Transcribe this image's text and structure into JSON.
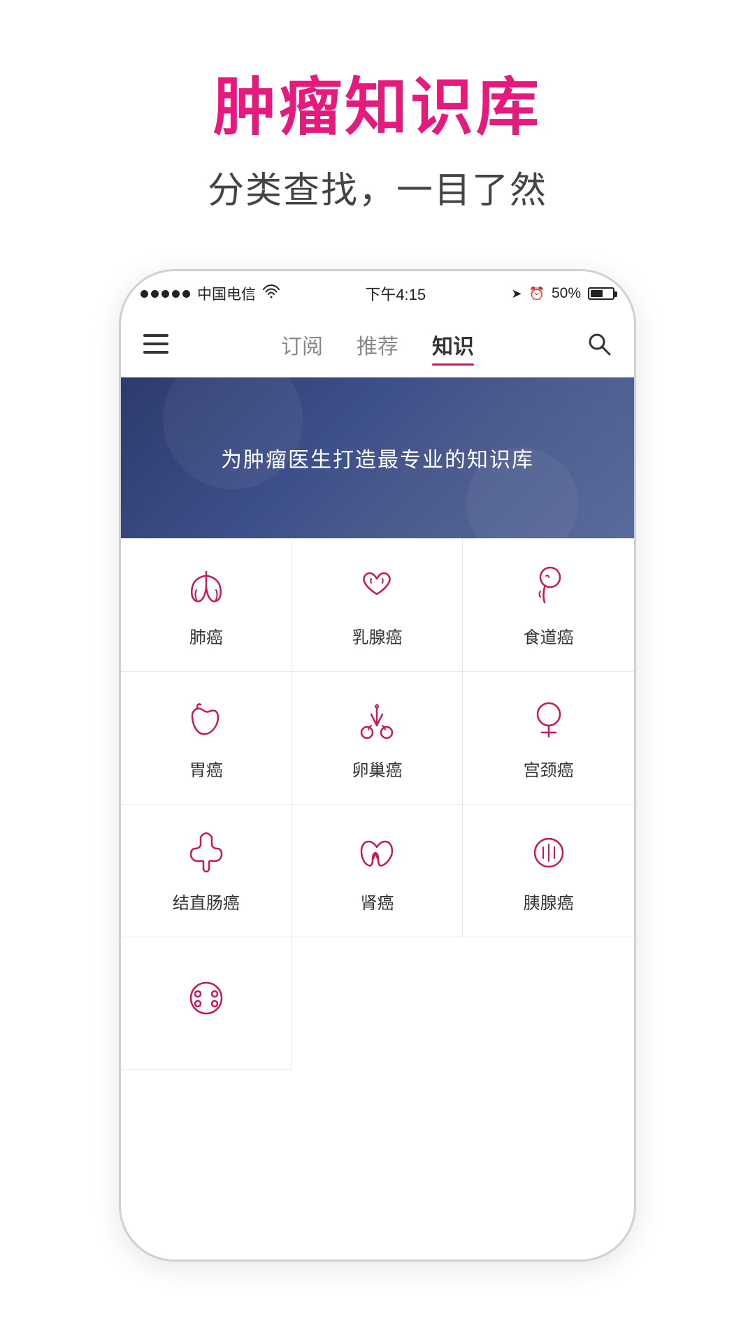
{
  "header": {
    "title": "肿瘤知识库",
    "subtitle": "分类查找，一目了然"
  },
  "statusBar": {
    "carrier": "中国电信",
    "time": "下午4:15",
    "battery": "50%"
  },
  "navBar": {
    "tabs": [
      {
        "label": "订阅",
        "active": false
      },
      {
        "label": "推荐",
        "active": false
      },
      {
        "label": "知识",
        "active": true
      }
    ]
  },
  "banner": {
    "text": "为肿瘤医生打造最专业的知识库"
  },
  "categories": [
    {
      "id": "lung",
      "label": "肺癌",
      "icon": "lung"
    },
    {
      "id": "breast",
      "label": "乳腺癌",
      "icon": "breast"
    },
    {
      "id": "esophagus",
      "label": "食道癌",
      "icon": "esophagus"
    },
    {
      "id": "stomach",
      "label": "胃癌",
      "icon": "stomach"
    },
    {
      "id": "ovary",
      "label": "卵巢癌",
      "icon": "ovary"
    },
    {
      "id": "cervix",
      "label": "宫颈癌",
      "icon": "cervix"
    },
    {
      "id": "colon",
      "label": "结直肠癌",
      "icon": "colon"
    },
    {
      "id": "kidney",
      "label": "肾癌",
      "icon": "kidney"
    },
    {
      "id": "pancreas",
      "label": "胰腺癌",
      "icon": "pancreas"
    },
    {
      "id": "other",
      "label": "",
      "icon": "other"
    }
  ]
}
